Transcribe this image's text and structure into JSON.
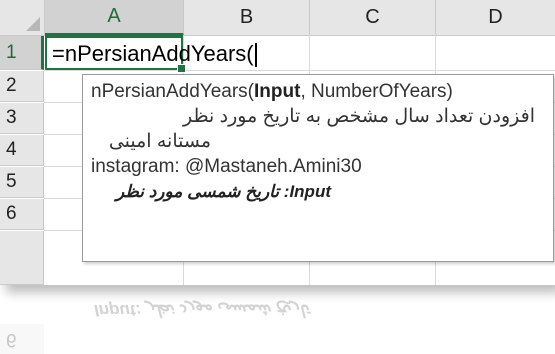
{
  "columns": [
    "A",
    "B",
    "C",
    "D"
  ],
  "rows": [
    "1",
    "2",
    "3",
    "4",
    "5",
    "6"
  ],
  "active_cell": {
    "column": "A",
    "row": "1"
  },
  "formula_text": "=nPersianAddYears(",
  "tooltip": {
    "signature_prefix": "nPersianAddYears(",
    "signature_bold_param": "Input",
    "signature_suffix": ", NumberOfYears)",
    "description_fa": "افزودن تعداد سال مشخص به تاریخ مورد نظر",
    "author_fa": "مستانه امینی",
    "instagram": "instagram: @Mastaneh.Amini30",
    "param_help": "Input: تاریخ شمسی مورد نظر"
  },
  "reflection_row_label": "6",
  "icons": {
    "select_all": "select-all-triangle-icon",
    "fill_handle": "fill-handle-icon"
  },
  "colors": {
    "accent": "#217346",
    "header_bg": "#e6e6e6"
  }
}
